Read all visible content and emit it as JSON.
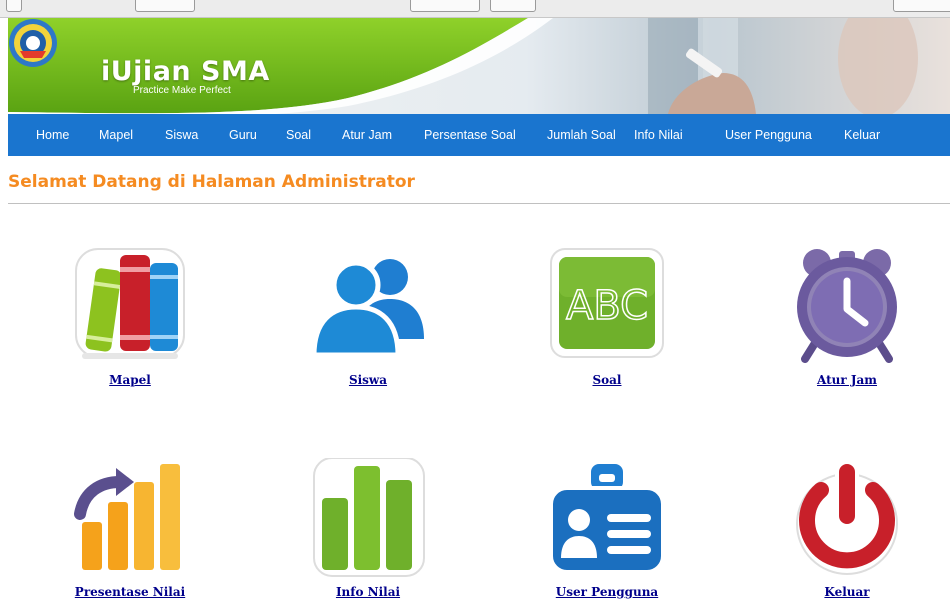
{
  "header": {
    "brand_title": "iUjian SMA",
    "brand_tagline": "Practice Make Perfect",
    "colors": {
      "banner_green": "#7dc21e",
      "nav_blue": "#1a75cf"
    }
  },
  "nav": {
    "items": [
      {
        "label": "Home"
      },
      {
        "label": "Mapel"
      },
      {
        "label": "Siswa"
      },
      {
        "label": "Guru"
      },
      {
        "label": "Soal"
      },
      {
        "label": "Atur Jam"
      },
      {
        "label": "Persentase Soal"
      },
      {
        "label": "Jumlah Soal"
      },
      {
        "label": "Info Nilai"
      },
      {
        "label": "User Pengguna"
      },
      {
        "label": "Keluar"
      }
    ]
  },
  "main": {
    "heading": "Selamat Datang di Halaman Administrator",
    "heading_color": "#f58b21",
    "tiles": [
      {
        "label": "Mapel",
        "icon": "books-icon"
      },
      {
        "label": "Siswa",
        "icon": "users-icon"
      },
      {
        "label": "Soal",
        "icon": "chalkboard-abc-icon"
      },
      {
        "label": "Atur Jam",
        "icon": "alarm-clock-icon"
      },
      {
        "label": "Presentase Nilai",
        "icon": "growth-chart-icon"
      },
      {
        "label": "Info Nilai",
        "icon": "bar-chart-icon"
      },
      {
        "label": "User Pengguna",
        "icon": "id-badge-icon"
      },
      {
        "label": "Keluar",
        "icon": "power-icon"
      }
    ],
    "icon_text": {
      "abc": "ABC"
    }
  }
}
